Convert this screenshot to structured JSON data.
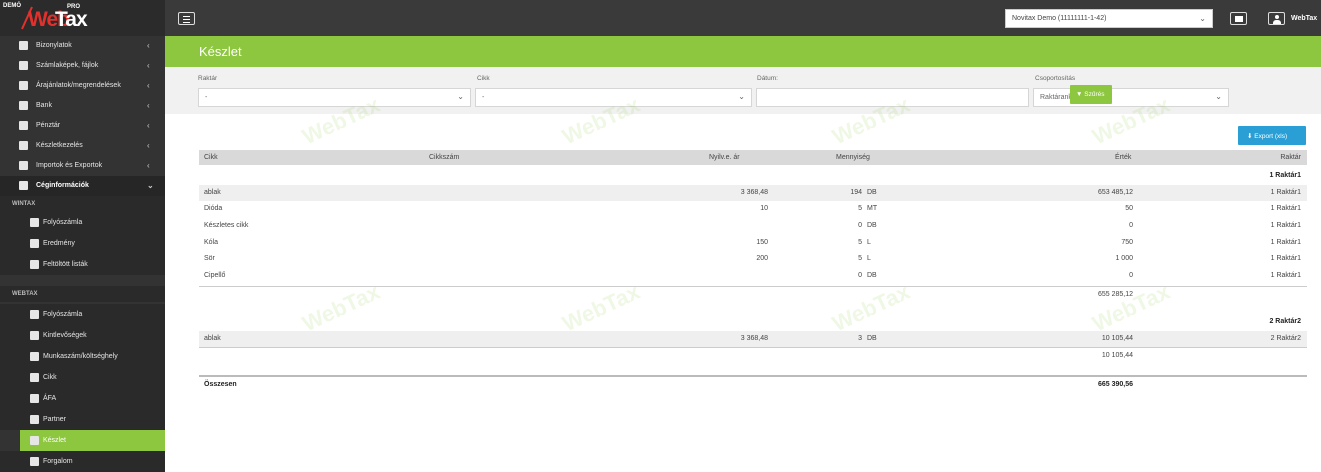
{
  "app": {
    "logo_demo": "DEMÓ",
    "logo_pro": "PRO",
    "logo_web": "Web",
    "logo_tax": "Tax",
    "company_selector": "Novitax Demo (11111111-1-42)",
    "user_name": "WebTax"
  },
  "sidebar": {
    "items": [
      {
        "label": "Bizonylatok",
        "icon": "document-icon"
      },
      {
        "label": "Számlaképek, fájlok",
        "icon": "file-icon"
      },
      {
        "label": "Árajánlatok/megrendelések",
        "icon": "cart-icon"
      },
      {
        "label": "Bank",
        "icon": "bank-icon"
      },
      {
        "label": "Pénztár",
        "icon": "piggy-bank-icon"
      },
      {
        "label": "Készletkezelés",
        "icon": "truck-icon"
      },
      {
        "label": "Importok és Exportok",
        "icon": "transfer-icon"
      },
      {
        "label": "Céginformációk",
        "icon": "company-icon"
      }
    ],
    "section_wintax": "WINTAX",
    "wintax_items": [
      {
        "label": "Folyószámla",
        "icon": "ledger-icon"
      },
      {
        "label": "Eredmény",
        "icon": "result-icon"
      },
      {
        "label": "Feltöltött listák",
        "icon": "list-icon"
      }
    ],
    "section_webtax": "WEBTAX",
    "webtax_items": [
      {
        "label": "Folyószámla",
        "icon": "ledger-icon"
      },
      {
        "label": "Kintlevőségek",
        "icon": "money-bag-icon"
      },
      {
        "label": "Munkaszám/költséghely",
        "icon": "pie-icon"
      },
      {
        "label": "Cikk",
        "icon": "barcode-icon"
      },
      {
        "label": "ÁFA",
        "icon": "search-icon"
      },
      {
        "label": "Partner",
        "icon": "handshake-icon"
      },
      {
        "label": "Készlet",
        "icon": "stock-icon"
      },
      {
        "label": "Forgalom",
        "icon": "truck-icon"
      }
    ]
  },
  "page": {
    "title": "Készlet"
  },
  "filters": {
    "warehouse_label": "Raktár",
    "warehouse_value": "-",
    "item_label": "Cikk",
    "item_value": "-",
    "date_label": "Dátum:",
    "date_value": "",
    "grouping_label": "Csoportosítás",
    "grouping_value": "Raktáranként",
    "filter_button": "Szűrés"
  },
  "export_button": "Export (xls)",
  "watermark": "WebTax",
  "table": {
    "headers": {
      "item": "Cikk",
      "item_no": "Cikkszám",
      "price": "Nyilv.e. ár",
      "quantity": "Mennyiség",
      "value": "Érték",
      "warehouse": "Raktár"
    },
    "groups": [
      {
        "name": "1 Raktár1",
        "rows": [
          {
            "item": "ablak",
            "item_no": "",
            "price": "3 368,48",
            "qty": "194",
            "unit": "DB",
            "value": "653 485,12",
            "warehouse": "1 Raktár1"
          },
          {
            "item": "Dióda",
            "item_no": "",
            "price": "10",
            "qty": "5",
            "unit": "MT",
            "value": "50",
            "warehouse": "1 Raktár1"
          },
          {
            "item": "Készletes cikk",
            "item_no": "",
            "price": "",
            "qty": "0",
            "unit": "DB",
            "value": "0",
            "warehouse": "1 Raktár1"
          },
          {
            "item": "Kóla",
            "item_no": "",
            "price": "150",
            "qty": "5",
            "unit": "L",
            "value": "750",
            "warehouse": "1 Raktár1"
          },
          {
            "item": "Sör",
            "item_no": "",
            "price": "200",
            "qty": "5",
            "unit": "L",
            "value": "1 000",
            "warehouse": "1 Raktár1"
          },
          {
            "item": "Cipellő",
            "item_no": "",
            "price": "",
            "qty": "0",
            "unit": "DB",
            "value": "0",
            "warehouse": "1 Raktár1"
          }
        ],
        "subtotal": "655 285,12"
      },
      {
        "name": "2 Raktár2",
        "rows": [
          {
            "item": "ablak",
            "item_no": "",
            "price": "3 368,48",
            "qty": "3",
            "unit": "DB",
            "value": "10 105,44",
            "warehouse": "2 Raktár2"
          }
        ],
        "subtotal": "10 105,44"
      }
    ],
    "total_label": "Összesen",
    "total_value": "665 390,56"
  }
}
